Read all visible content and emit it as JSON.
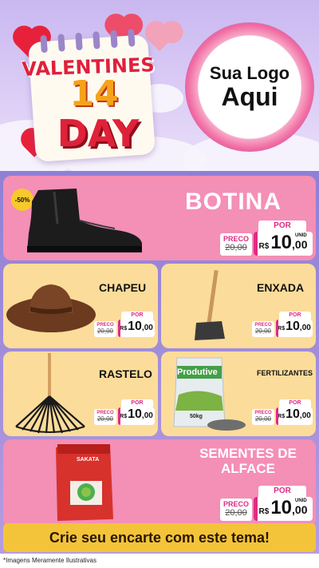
{
  "header": {
    "title_top": "VALENTINES",
    "title_number": "14",
    "title_bottom": "DAY",
    "logo_line1": "Sua Logo",
    "logo_line2": "Aqui"
  },
  "products": [
    {
      "id": "botina",
      "name": "BOTINA",
      "badge": "-50%",
      "preco_label": "PRECO",
      "old_price": "20,00",
      "old_prefix": "R$",
      "por_label": "POR",
      "currency": "R$",
      "price_int": "10",
      "price_dec": ",00",
      "unit": "UNID"
    },
    {
      "id": "chapeu",
      "name": "CHAPEU",
      "preco_label": "PRECO",
      "old_price": "20,00",
      "old_prefix": "R$",
      "por_label": "POR",
      "currency": "R$",
      "price_int": "10",
      "price_dec": ",00",
      "unit": "UNID"
    },
    {
      "id": "enxada",
      "name": "ENXADA",
      "preco_label": "PRECO",
      "old_price": "20,00",
      "old_prefix": "R$",
      "por_label": "POR",
      "currency": "R$",
      "price_int": "10",
      "price_dec": ",00",
      "unit": "UNID"
    },
    {
      "id": "rastelo",
      "name": "RASTELO",
      "preco_label": "PRECO",
      "old_price": "20,00",
      "old_prefix": "R$",
      "por_label": "POR",
      "currency": "R$",
      "price_int": "10",
      "price_dec": ",00",
      "unit": "UNID"
    },
    {
      "id": "fertilizantes",
      "name": "FERTILIZANTES",
      "bag_brand": "Produtive",
      "bag_weight": "50kg",
      "preco_label": "PRECO",
      "old_price": "20,00",
      "old_prefix": "R$",
      "por_label": "POR",
      "currency": "R$",
      "price_int": "10",
      "price_dec": ",00",
      "unit": "UNID"
    },
    {
      "id": "sementes",
      "name_line1": "SEMENTES DE",
      "name_line2": "ALFACE",
      "pack_brand": "SAKATA",
      "preco_label": "PRECO",
      "old_price": "20,00",
      "old_prefix": "R$",
      "por_label": "POR",
      "currency": "R$",
      "price_int": "10",
      "price_dec": ",00",
      "unit": "UNID"
    }
  ],
  "cta": {
    "label": "Crie seu encarte com este tema!"
  },
  "footnote": "*Imagens Meramente Ilustrativas",
  "colors": {
    "pink_card": "#f48fb6",
    "cream_card": "#fcdc9a",
    "accent_pink": "#e02a84",
    "cta_yellow": "#f3c43a",
    "valentine_red": "#e0213a"
  }
}
